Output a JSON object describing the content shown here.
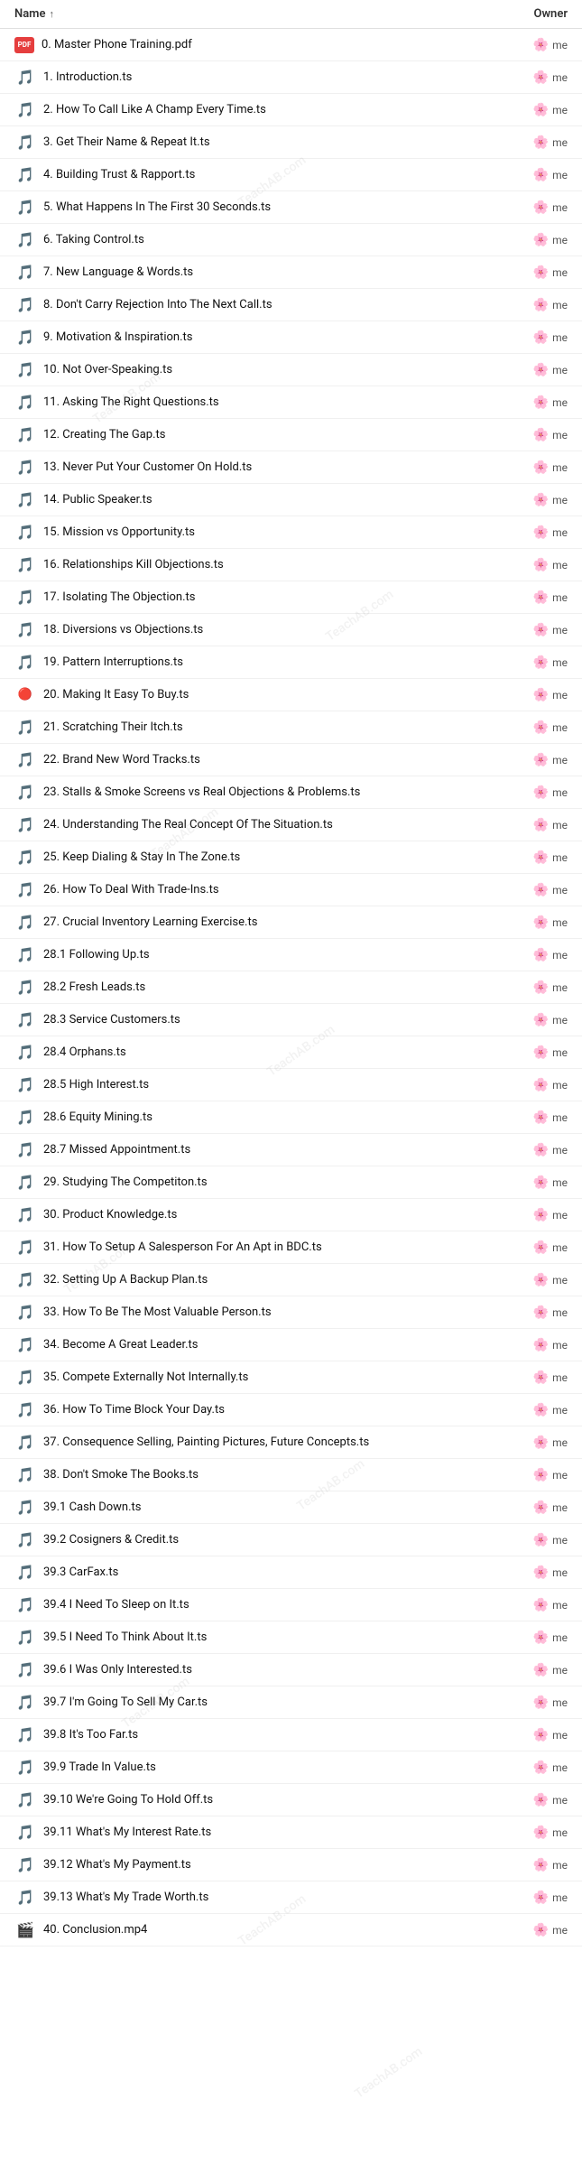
{
  "header": {
    "name_label": "Name",
    "sort_icon": "↑",
    "owner_label": "Owner"
  },
  "files": [
    {
      "id": 0,
      "name": "0. Master Phone Training.pdf",
      "type": "pdf",
      "owner": "me"
    },
    {
      "id": 1,
      "name": "1. Introduction.ts",
      "type": "ts",
      "owner": "me"
    },
    {
      "id": 2,
      "name": "2. How To Call Like A Champ Every Time.ts",
      "type": "ts",
      "owner": "me"
    },
    {
      "id": 3,
      "name": "3. Get Their Name & Repeat It.ts",
      "type": "ts",
      "owner": "me"
    },
    {
      "id": 4,
      "name": "4. Building Trust & Rapport.ts",
      "type": "ts",
      "owner": "me"
    },
    {
      "id": 5,
      "name": "5. What Happens In The First 30 Seconds.ts",
      "type": "ts",
      "owner": "me"
    },
    {
      "id": 6,
      "name": "6. Taking Control.ts",
      "type": "ts",
      "owner": "me"
    },
    {
      "id": 7,
      "name": "7. New Language & Words.ts",
      "type": "ts",
      "owner": "me"
    },
    {
      "id": 8,
      "name": "8. Don't Carry Rejection Into The Next Call.ts",
      "type": "ts",
      "owner": "me"
    },
    {
      "id": 9,
      "name": "9. Motivation & Inspiration.ts",
      "type": "ts",
      "owner": "me"
    },
    {
      "id": 10,
      "name": "10. Not Over-Speaking.ts",
      "type": "ts",
      "owner": "me"
    },
    {
      "id": 11,
      "name": "11. Asking The Right Questions.ts",
      "type": "ts",
      "owner": "me"
    },
    {
      "id": 12,
      "name": "12. Creating The Gap.ts",
      "type": "ts",
      "owner": "me"
    },
    {
      "id": 13,
      "name": "13. Never Put Your Customer On Hold.ts",
      "type": "ts",
      "owner": "me"
    },
    {
      "id": 14,
      "name": "14. Public Speaker.ts",
      "type": "ts",
      "owner": "me"
    },
    {
      "id": 15,
      "name": "15. Mission vs Opportunity.ts",
      "type": "ts",
      "owner": "me"
    },
    {
      "id": 16,
      "name": "16. Relationships Kill Objections.ts",
      "type": "ts",
      "owner": "me"
    },
    {
      "id": 17,
      "name": "17. Isolating The Objection.ts",
      "type": "ts",
      "owner": "me"
    },
    {
      "id": 18,
      "name": "18. Diversions vs Objections.ts",
      "type": "ts",
      "owner": "me"
    },
    {
      "id": 19,
      "name": "19. Pattern Interruptions.ts",
      "type": "ts",
      "owner": "me"
    },
    {
      "id": 20,
      "name": "20. Making It Easy To Buy.ts",
      "type": "ts-special",
      "owner": "me"
    },
    {
      "id": 21,
      "name": "21. Scratching Their Itch.ts",
      "type": "ts",
      "owner": "me"
    },
    {
      "id": 22,
      "name": "22. Brand New Word Tracks.ts",
      "type": "ts",
      "owner": "me"
    },
    {
      "id": 23,
      "name": "23. Stalls & Smoke Screens vs Real Objections & Problems.ts",
      "type": "ts",
      "owner": "me"
    },
    {
      "id": 24,
      "name": "24. Understanding The Real Concept Of The Situation.ts",
      "type": "ts",
      "owner": "me"
    },
    {
      "id": 25,
      "name": "25. Keep Dialing & Stay In The Zone.ts",
      "type": "ts",
      "owner": "me"
    },
    {
      "id": 26,
      "name": "26. How To Deal With Trade-Ins.ts",
      "type": "ts",
      "owner": "me"
    },
    {
      "id": 27,
      "name": "27. Crucial Inventory Learning Exercise.ts",
      "type": "ts",
      "owner": "me"
    },
    {
      "id": 28,
      "name": "28.1 Following Up.ts",
      "type": "ts",
      "owner": "me"
    },
    {
      "id": 29,
      "name": "28.2 Fresh Leads.ts",
      "type": "ts",
      "owner": "me"
    },
    {
      "id": 30,
      "name": "28.3 Service Customers.ts",
      "type": "ts",
      "owner": "me"
    },
    {
      "id": 31,
      "name": "28.4 Orphans.ts",
      "type": "ts",
      "owner": "me"
    },
    {
      "id": 32,
      "name": "28.5 High Interest.ts",
      "type": "ts",
      "owner": "me"
    },
    {
      "id": 33,
      "name": "28.6 Equity Mining.ts",
      "type": "ts",
      "owner": "me"
    },
    {
      "id": 34,
      "name": "28.7 Missed Appointment.ts",
      "type": "ts",
      "owner": "me"
    },
    {
      "id": 35,
      "name": "29. Studying The Competiton.ts",
      "type": "ts",
      "owner": "me"
    },
    {
      "id": 36,
      "name": "30. Product Knowledge.ts",
      "type": "ts",
      "owner": "me"
    },
    {
      "id": 37,
      "name": "31. How To Setup A Salesperson For An Apt in BDC.ts",
      "type": "ts",
      "owner": "me"
    },
    {
      "id": 38,
      "name": "32. Setting Up A Backup Plan.ts",
      "type": "ts",
      "owner": "me"
    },
    {
      "id": 39,
      "name": "33. How To Be The Most Valuable Person.ts",
      "type": "ts",
      "owner": "me"
    },
    {
      "id": 40,
      "name": "34. Become A Great Leader.ts",
      "type": "ts",
      "owner": "me"
    },
    {
      "id": 41,
      "name": "35. Compete Externally Not Internally.ts",
      "type": "ts",
      "owner": "me"
    },
    {
      "id": 42,
      "name": "36. How To Time Block Your Day.ts",
      "type": "ts",
      "owner": "me"
    },
    {
      "id": 43,
      "name": "37. Consequence Selling, Painting Pictures, Future Concepts.ts",
      "type": "ts",
      "owner": "me"
    },
    {
      "id": 44,
      "name": "38. Don't Smoke The Books.ts",
      "type": "ts",
      "owner": "me"
    },
    {
      "id": 45,
      "name": "39.1 Cash Down.ts",
      "type": "ts",
      "owner": "me"
    },
    {
      "id": 46,
      "name": "39.2 Cosigners & Credit.ts",
      "type": "ts",
      "owner": "me"
    },
    {
      "id": 47,
      "name": "39.3 CarFax.ts",
      "type": "ts",
      "owner": "me"
    },
    {
      "id": 48,
      "name": "39.4 I Need To Sleep on It.ts",
      "type": "ts",
      "owner": "me"
    },
    {
      "id": 49,
      "name": "39.5 I Need To Think About It.ts",
      "type": "ts",
      "owner": "me"
    },
    {
      "id": 50,
      "name": "39.6 I Was Only Interested.ts",
      "type": "ts",
      "owner": "me"
    },
    {
      "id": 51,
      "name": "39.7 I'm Going To Sell My Car.ts",
      "type": "ts",
      "owner": "me"
    },
    {
      "id": 52,
      "name": "39.8 It's Too Far.ts",
      "type": "ts",
      "owner": "me"
    },
    {
      "id": 53,
      "name": "39.9 Trade In Value.ts",
      "type": "ts",
      "owner": "me"
    },
    {
      "id": 54,
      "name": "39.10 We're Going To Hold Off.ts",
      "type": "ts",
      "owner": "me"
    },
    {
      "id": 55,
      "name": "39.11 What's My Interest Rate.ts",
      "type": "ts",
      "owner": "me"
    },
    {
      "id": 56,
      "name": "39.12 What's My Payment.ts",
      "type": "ts",
      "owner": "me"
    },
    {
      "id": 57,
      "name": "39.13 What's My Trade Worth.ts",
      "type": "ts",
      "owner": "me"
    },
    {
      "id": 58,
      "name": "40. Conclusion.mp4",
      "type": "mp4",
      "owner": "me"
    }
  ],
  "watermark_text": "TeachAB.com"
}
